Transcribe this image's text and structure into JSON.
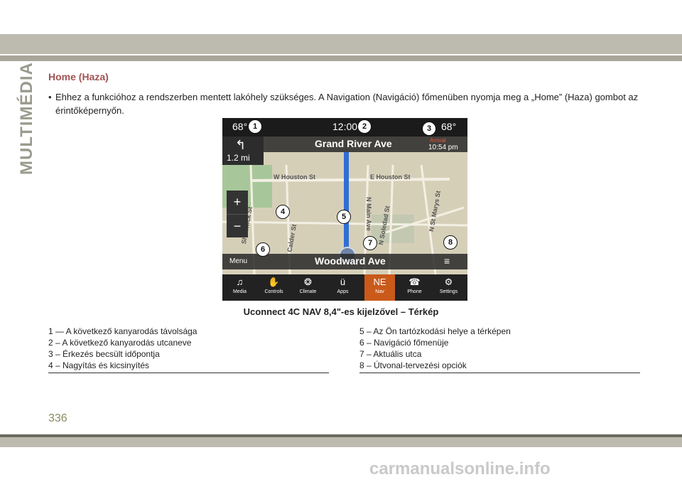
{
  "page": {
    "side_label": "MULTIMÉDIA",
    "heading": "Home (Haza)",
    "bullet": "•",
    "paragraph": "Ehhez a funkcióhoz a rendszerben mentett lakóhely szükséges. A Navigation (Navigáció) főmenüben nyomja meg a „Home” (Haza) gombot az érintőképernyőn.",
    "caption": "Uconnect 4C NAV 8,4\"-es kijelzővel – Térkép",
    "page_number": "336",
    "watermark": "carmanualsonline.info"
  },
  "screen": {
    "temp_left": "68°",
    "time": "12:00",
    "temp_right": "68°",
    "turn_distance": "1.2 mi",
    "next_street": "Grand River Ave",
    "eta_label": "Arrival",
    "eta_time": "10:54 pm",
    "menu_label": "Menu",
    "current_street": "Woodward Ave",
    "zoom_in": "+",
    "zoom_out": "−",
    "streets": [
      "W Houston St",
      "E Houston St",
      "N Main Ave",
      "Calder St",
      "N Soledad St",
      "N St Marys St",
      "Shadwick St"
    ],
    "dock": [
      {
        "label": "Media",
        "icon": "music-note-icon",
        "glyph": "♫"
      },
      {
        "label": "Controls",
        "icon": "controls-icon",
        "glyph": "✋"
      },
      {
        "label": "Climate",
        "icon": "climate-icon",
        "glyph": "❂"
      },
      {
        "label": "Apps",
        "icon": "apps-icon",
        "glyph": "ü"
      },
      {
        "label": "Nav",
        "icon": "compass-icon",
        "glyph": "NE"
      },
      {
        "label": "Phone",
        "icon": "phone-icon",
        "glyph": "☎"
      },
      {
        "label": "Settings",
        "icon": "gear-icon",
        "glyph": "⚙"
      }
    ],
    "callouts": [
      "1",
      "2",
      "3",
      "4",
      "5",
      "6",
      "7",
      "8"
    ]
  },
  "legend": {
    "left": [
      "1 — A következő kanyarodás távolsága",
      "2 – A következő kanyarodás utcaneve",
      "3 – Érkezés becsült időpontja",
      "4 – Nagyítás és kicsinyítés"
    ],
    "right": [
      "5 – Az Ön tartózkodási helye a térképen",
      "6 – Navigáció főmenüje",
      "7 – Aktuális utca",
      "8 – Útvonal-tervezési opciók"
    ]
  },
  "colors": {
    "heading": "#a05353",
    "band": "#bdbab0",
    "nav_active": "#c95a1a",
    "route": "#2f6fd6"
  }
}
